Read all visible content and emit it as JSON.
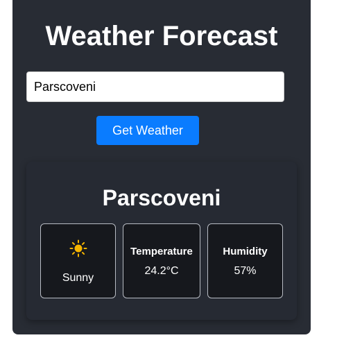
{
  "app": {
    "title": "Weather Forecast"
  },
  "search": {
    "value": "Parscoveni",
    "button_label": "Get Weather"
  },
  "result": {
    "city": "Parscoveni",
    "condition": {
      "icon": "sun-icon",
      "text": "Sunny"
    },
    "temperature": {
      "label": "Temperature",
      "value": "24.2°C"
    },
    "humidity": {
      "label": "Humidity",
      "value": "57%"
    }
  },
  "colors": {
    "card_bg": "#282c34",
    "button": "#0a7cff",
    "tile_bg": "#16181d",
    "sun": "#f5b400"
  }
}
